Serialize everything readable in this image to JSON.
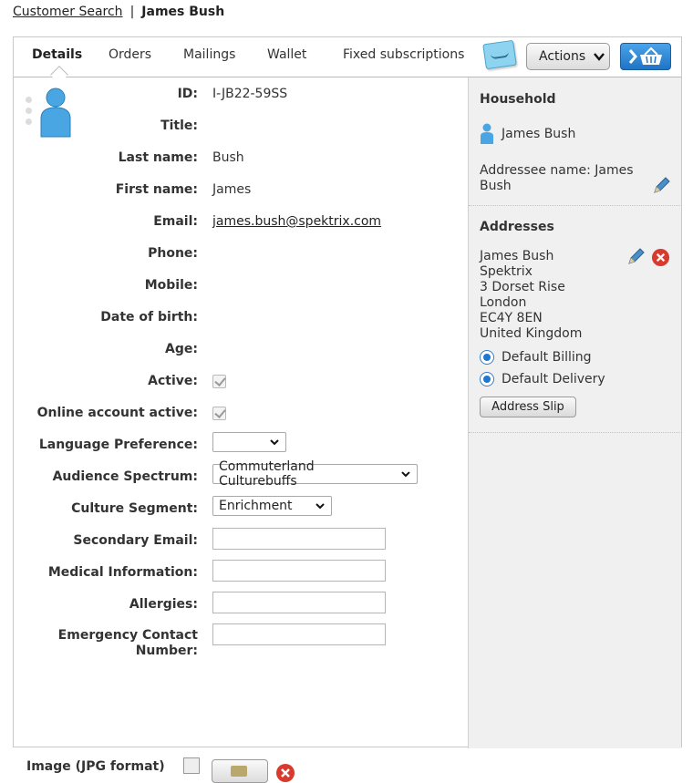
{
  "breadcrumb": {
    "link": "Customer Search",
    "separator": "|",
    "current": "James Bush"
  },
  "tabs": [
    {
      "label": "Details",
      "active": true
    },
    {
      "label": "Orders",
      "active": false
    },
    {
      "label": "Mailings",
      "active": false
    },
    {
      "label": "Wallet",
      "active": false
    },
    {
      "label": "Fixed subscriptions",
      "active": false
    }
  ],
  "toolbar": {
    "actions_label": "Actions",
    "note_icon": "sticky-note-icon",
    "basket_icon": "basket-icon"
  },
  "details": {
    "id": {
      "label": "ID:",
      "value": "I-JB22-59SS"
    },
    "title": {
      "label": "Title:",
      "value": ""
    },
    "last_name": {
      "label": "Last name:",
      "value": "Bush"
    },
    "first_name": {
      "label": "First name:",
      "value": "James"
    },
    "email": {
      "label": "Email:",
      "value": "james.bush@spektrix.com"
    },
    "phone": {
      "label": "Phone:",
      "value": ""
    },
    "mobile": {
      "label": "Mobile:",
      "value": ""
    },
    "dob": {
      "label": "Date of birth:",
      "value": ""
    },
    "age": {
      "label": "Age:",
      "value": ""
    },
    "active": {
      "label": "Active:",
      "checked": true
    },
    "online_active": {
      "label": "Online account active:",
      "checked": true
    },
    "language": {
      "label": "Language Preference:",
      "value": ""
    },
    "audience": {
      "label": "Audience Spectrum:",
      "value": "Commuterland Culturebuffs"
    },
    "culture": {
      "label": "Culture Segment:",
      "value": "Enrichment"
    },
    "secondary_email": {
      "label": "Secondary Email:",
      "value": ""
    },
    "medical": {
      "label": "Medical Information:",
      "value": ""
    },
    "allergies": {
      "label": "Allergies:",
      "value": ""
    },
    "emergency": {
      "label_line1": "Emergency Contact",
      "label_line2": "Number:",
      "value": ""
    },
    "image": {
      "label": "Image (JPG format)"
    }
  },
  "household": {
    "title": "Household",
    "member": "James Bush",
    "addressee": "Addressee name: James Bush"
  },
  "addresses": {
    "title": "Addresses",
    "lines": [
      "James Bush",
      "Spektrix",
      "3 Dorset Rise",
      "London",
      "EC4Y 8EN",
      "United Kingdom"
    ],
    "default_billing": "Default Billing",
    "default_delivery": "Default Delivery",
    "slip_button": "Address Slip"
  },
  "colors": {
    "accent_blue": "#1f74c4",
    "delete_red": "#d93a2e",
    "sidebar_bg": "#f0f0f0"
  }
}
